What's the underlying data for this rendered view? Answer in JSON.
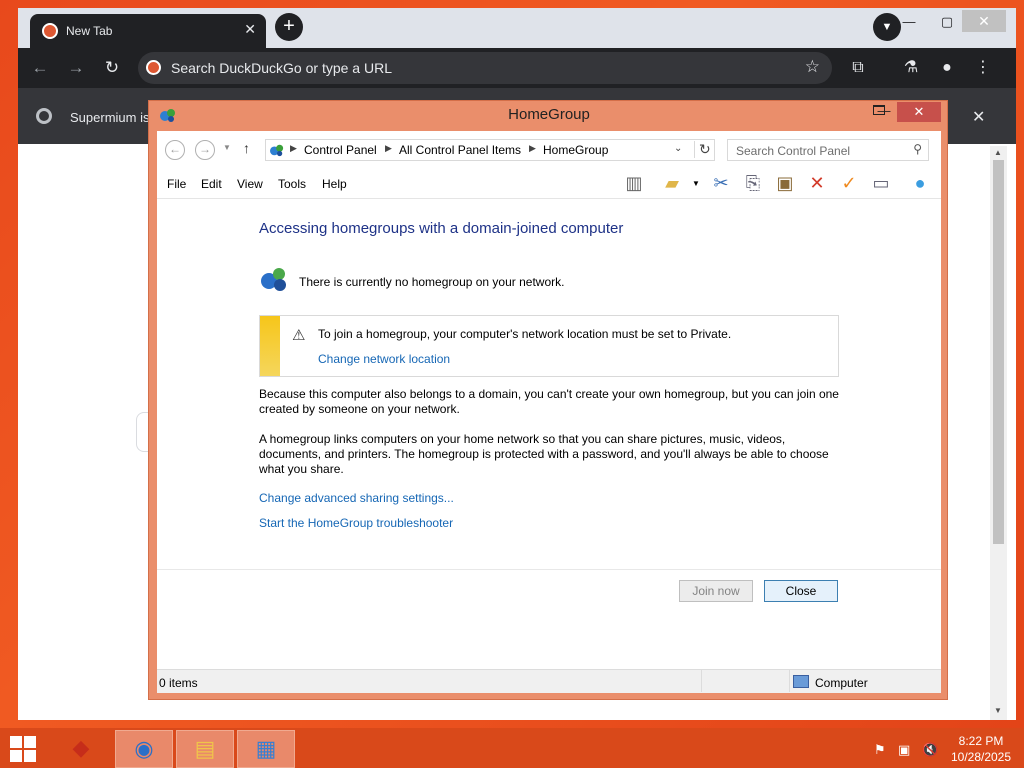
{
  "browser": {
    "tab_title": "New Tab",
    "omnibox_placeholder": "Search DuckDuckGo or type a URL",
    "infobar_text": "Supermium is"
  },
  "window": {
    "title": "HomeGroup",
    "address": [
      "Control Panel",
      "All Control Panel Items",
      "HomeGroup"
    ],
    "search_placeholder": "Search Control Panel",
    "menus": [
      "File",
      "Edit",
      "View",
      "Tools",
      "Help"
    ]
  },
  "content": {
    "heading": "Accessing homegroups with a domain-joined computer",
    "no_homegroup": "There is currently no homegroup on your network.",
    "warning_text": "To join a homegroup, your computer's network location must be set to Private.",
    "warning_link": "Change network location",
    "para1_line1": "Because this computer also belongs to a domain, you can't create your own homegroup, but you can join one",
    "para1_line2": "created by someone on your network.",
    "para2_line1": "A homegroup links computers on your home network so that you can share pictures, music, videos,",
    "para2_line2": "documents, and printers. The homegroup is protected with a password, and you'll always be able to choose",
    "para2_line3": "what you share.",
    "link_advanced": "Change advanced sharing settings...",
    "link_troubleshooter": "Start the HomeGroup troubleshooter"
  },
  "buttons": {
    "join": "Join now",
    "close": "Close"
  },
  "statusbar": {
    "items": "0 items",
    "zone": "Computer"
  },
  "taskbar": {
    "time": "8:22 PM",
    "date": "10/28/2025"
  },
  "colors": {
    "desktop": "#e8491c",
    "window_frame": "#ea8e6b",
    "link": "#1667b5",
    "heading": "#1e3287"
  }
}
